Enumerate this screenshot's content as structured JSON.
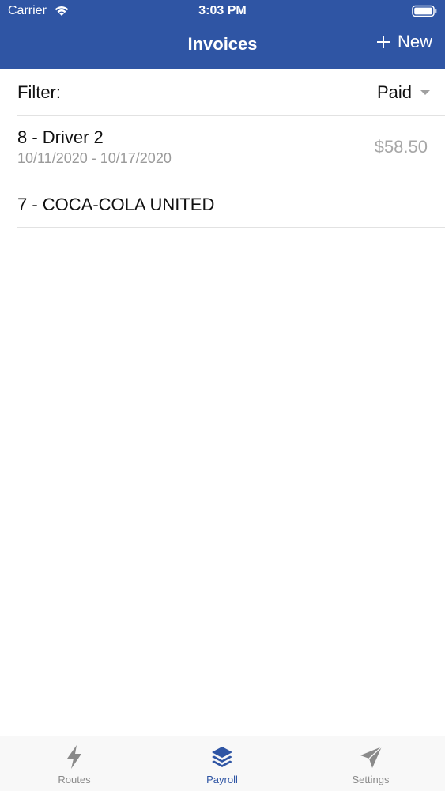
{
  "status_bar": {
    "carrier": "Carrier",
    "time": "3:03 PM"
  },
  "nav": {
    "title": "Invoices",
    "new_label": "New"
  },
  "filter": {
    "label": "Filter:",
    "selected": "Paid"
  },
  "invoices": [
    {
      "title": "8 - Driver 2",
      "dates": "10/11/2020 - 10/17/2020",
      "amount": "$58.50"
    },
    {
      "title": "7 - COCA-COLA UNITED"
    }
  ],
  "tabs": [
    {
      "label": "Routes",
      "icon": "bolt-icon"
    },
    {
      "label": "Payroll",
      "icon": "layers-icon",
      "active": true
    },
    {
      "label": "Settings",
      "icon": "paper-plane-icon"
    }
  ],
  "colors": {
    "brand": "#2f55a4",
    "inactive": "#8a8a8a",
    "secondary_text": "#9a9a9a"
  }
}
